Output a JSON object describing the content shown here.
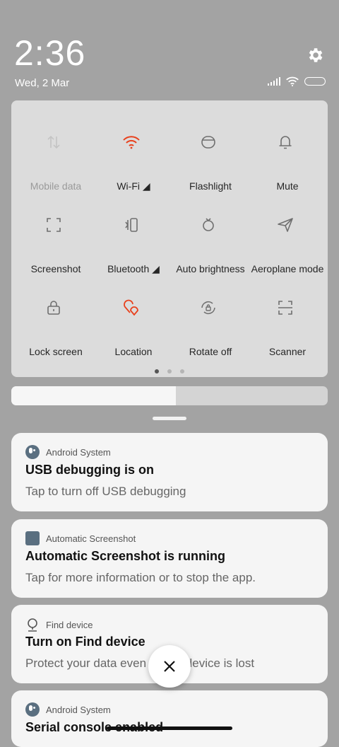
{
  "status_bar": {
    "time": "2:36",
    "date": "Wed, 2 Mar",
    "icons": [
      "signal-icon",
      "wifi-icon",
      "battery-icon"
    ]
  },
  "settings_icon": "gear-icon",
  "quick_settings": {
    "tiles": [
      {
        "label": "Mobile data",
        "icon": "mobile-data-icon",
        "active": false,
        "dimmed": true
      },
      {
        "label": "Wi-Fi ◢",
        "icon": "wifi-icon",
        "active": true,
        "dimmed": false
      },
      {
        "label": "Flashlight",
        "icon": "flashlight-icon",
        "active": false,
        "dimmed": false
      },
      {
        "label": "Mute",
        "icon": "bell-icon",
        "active": false,
        "dimmed": false
      },
      {
        "label": "Screenshot",
        "icon": "screenshot-icon",
        "active": false,
        "dimmed": false
      },
      {
        "label": "Bluetooth ◢",
        "icon": "bluetooth-icon",
        "active": false,
        "dimmed": false
      },
      {
        "label": "Auto brightness",
        "icon": "auto-brightness-icon",
        "active": false,
        "dimmed": false
      },
      {
        "label": "Aeroplane mode",
        "icon": "aeroplane-icon",
        "active": false,
        "dimmed": false
      },
      {
        "label": "Lock screen",
        "icon": "lock-icon",
        "active": false,
        "dimmed": false
      },
      {
        "label": "Location",
        "icon": "location-icon",
        "active": true,
        "dimmed": false
      },
      {
        "label": "Rotate off",
        "icon": "rotate-lock-icon",
        "active": false,
        "dimmed": false
      },
      {
        "label": "Scanner",
        "icon": "scanner-icon",
        "active": false,
        "dimmed": false
      }
    ],
    "pages": 3,
    "current_page": 1
  },
  "brightness": {
    "level": 0.52
  },
  "notifications": [
    {
      "app": "Android System",
      "icon": "android-system-icon",
      "title": "USB debugging is on",
      "body": "Tap to turn off USB debugging"
    },
    {
      "app": "Automatic Screenshot",
      "icon": "automatic-screenshot-icon",
      "title": "Automatic Screenshot is running",
      "body": "Tap for more information or to stop the app."
    },
    {
      "app": "Find device",
      "icon": "find-device-icon",
      "title": "Turn on Find device",
      "body": "Protect your data even if your device is lost"
    },
    {
      "app": "Android System",
      "icon": "android-system-icon",
      "title": "Serial console enabled",
      "body": ""
    }
  ],
  "colors": {
    "accent": "#e8401c",
    "tile_icon": "#6f6f6f",
    "panel_bg": "#dcdcdc",
    "background": "#a3a3a3"
  },
  "dismiss_icon": "close-icon"
}
